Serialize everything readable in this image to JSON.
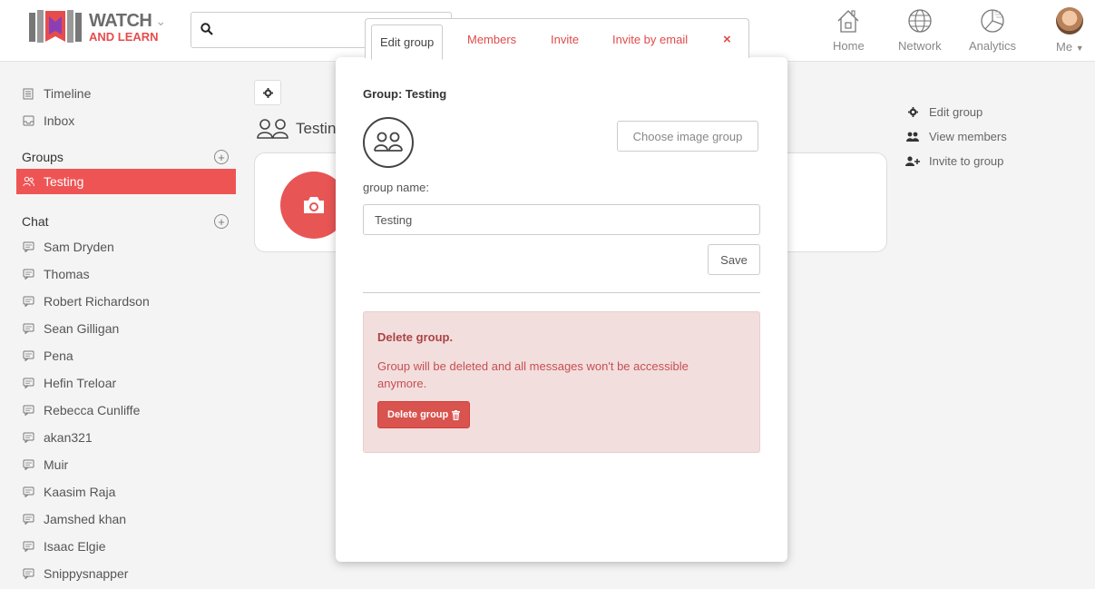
{
  "brand": {
    "line1": "WATCH",
    "line2": "AND LEARN"
  },
  "search": {
    "placeholder": ""
  },
  "nav": {
    "home": "Home",
    "network": "Network",
    "analytics": "Analytics",
    "me": "Me"
  },
  "sidebar": {
    "timeline": "Timeline",
    "inbox": "Inbox",
    "groups_heading": "Groups",
    "active_group": "Testing",
    "chat_heading": "Chat",
    "chats": [
      "Sam Dryden",
      "Thomas",
      "Robert Richardson",
      "Sean Gilligan",
      "Pena",
      "Hefin Treloar",
      "Rebecca Cunliffe",
      "akan321",
      "Muir",
      "Kaasim Raja",
      "Jamshed khan",
      "Isaac Elgie",
      "Snippysnapper"
    ]
  },
  "main": {
    "group_title": "Testin"
  },
  "right_actions": {
    "edit": "Edit group",
    "view": "View members",
    "invite": "Invite to group"
  },
  "modal": {
    "tabs": {
      "edit": "Edit group",
      "members": "Members",
      "invite": "Invite",
      "invite_email": "Invite by email",
      "close": "×"
    },
    "title": "Group: Testing",
    "choose_image": "Choose image group",
    "name_label": "group name:",
    "name_value": "Testing",
    "save": "Save",
    "danger_title": "Delete group.",
    "danger_text": "Group will be deleted and all messages won't be accessible anymore.",
    "delete_button": "Delete group"
  },
  "colors": {
    "accent": "#ef5455",
    "danger_bg": "#f3dede",
    "danger_text": "#a94442",
    "delete_btn": "#d9534f"
  }
}
